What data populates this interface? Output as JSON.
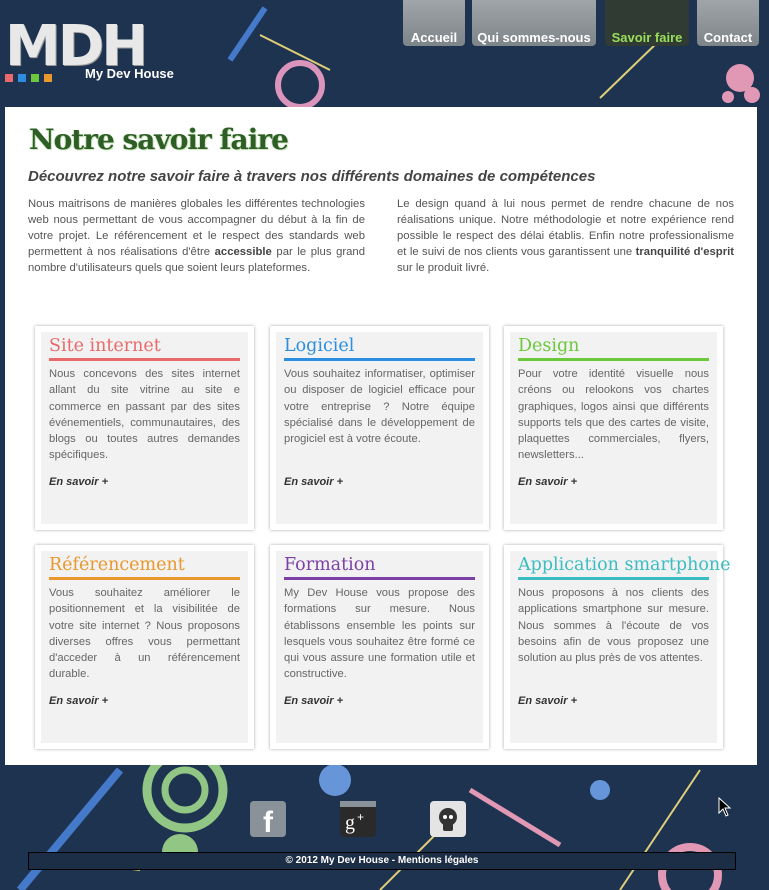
{
  "header": {
    "logo_letters": "MDH",
    "logo_subtitle": "My Dev House",
    "nav": [
      {
        "label": "Accueil",
        "active": false
      },
      {
        "label": "Qui sommes-nous",
        "active": false
      },
      {
        "label": "Savoir faire",
        "active": true
      },
      {
        "label": "Contact",
        "active": false
      }
    ]
  },
  "main": {
    "title": "Notre savoir faire",
    "intro": "Découvrez notre savoir faire à travers nos différents domaines de compétences",
    "col_left": {
      "text_before": "Nous maitrisons de manières globales les différentes technologies web nous permettant de vous accompagner du début à la fin de votre projet. Le référencement et le respect des standards web permettent à nos réalisations d'être ",
      "strong": "accessible",
      "text_after": " par le plus grand nombre d'utilisateurs quels que soient leurs plateformes."
    },
    "col_right": {
      "text_before": "Le design quand à lui nous permet de rendre chacune de nos réalisations unique. Notre méthodologie et notre expérience rend possible le respect des délai établis. Enfin notre professionalisme et le suivi de nos clients vous garantissent une ",
      "strong": "tranquilité d'esprit",
      "text_after": " sur le produit livré."
    },
    "cards": [
      {
        "title": "Site internet",
        "color": "#e86a6a",
        "text": "Nous concevons des sites internet allant du site vitrine au site e commerce en passant par des sites événementiels, communautaires, des blogs ou toutes autres demandes spécifiques.",
        "more": "En savoir +"
      },
      {
        "title": "Logiciel",
        "color": "#2b8ee0",
        "text": "Vous souhaitez informatiser, optimiser ou disposer de logiciel efficace pour votre entreprise ? Notre équipe spécialisé dans le développement de progiciel est à votre écoute.",
        "more": "En savoir +"
      },
      {
        "title": "Design",
        "color": "#6cc93c",
        "text": "Pour votre identité visuelle nous créons ou relookons vos chartes graphiques, logos ainsi que différents supports tels que des cartes de visite, plaquettes commerciales, flyers, newsletters...",
        "more": "En savoir +"
      },
      {
        "title": "Référencement",
        "color": "#e8982c",
        "text": "Vous souhaitez améliorer le positionnement et la visibilitée de votre site internet ? Nous proposons diverses offres vous permettant d'acceder à un référencement durable.",
        "more": "En savoir +"
      },
      {
        "title": "Formation",
        "color": "#7b3fa6",
        "text": "My Dev House vous propose des formations sur mesure. Nous établissons ensemble les points sur lesquels vous souhaitez être formé ce qui vous assure une formation utile et constructive.",
        "more": "En savoir +"
      },
      {
        "title": "Application smartphone",
        "color": "#3bbcc2",
        "text": "Nous proposons à nos clients des applications smartphone sur mesure. Nous sommes à l'écoute de vos besoins afin de vous proposez une solution au plus près de vos attentes.",
        "more": "En savoir +"
      }
    ]
  },
  "footer": {
    "social": [
      {
        "icon": "facebook-icon",
        "glyph": "f"
      },
      {
        "icon": "google-plus-icon",
        "glyph": "g+"
      },
      {
        "icon": "github-icon",
        "glyph": ""
      }
    ],
    "copyright": "© 2012 My Dev House - Mentions légales"
  },
  "colors": {
    "background": "#1e3350",
    "title_green": "#2e5e26",
    "nav_active_text": "#9adf5a"
  }
}
